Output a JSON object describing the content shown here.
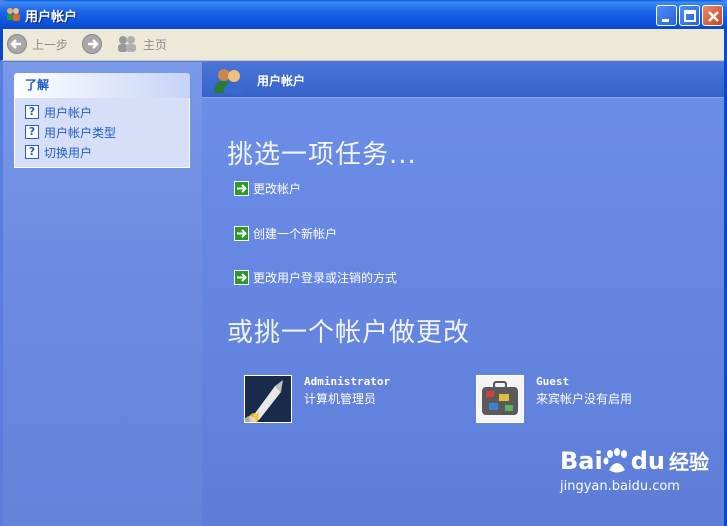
{
  "window": {
    "title": "用户帐户"
  },
  "toolbar": {
    "back_label": "上一步",
    "home_label": "主页"
  },
  "sidebar": {
    "header": "了解",
    "links": [
      {
        "label": "用户帐户"
      },
      {
        "label": "用户帐户类型"
      },
      {
        "label": "切换用户"
      }
    ]
  },
  "main": {
    "header_title": "用户帐户",
    "task_heading": "挑选一项任务...",
    "tasks": [
      {
        "label": "更改帐户"
      },
      {
        "label": "创建一个新帐户"
      },
      {
        "label": "更改用户登录或注销的方式"
      }
    ],
    "account_heading": "或挑一个帐户做更改",
    "accounts": [
      {
        "name": "Administrator",
        "description": "计算机管理员"
      },
      {
        "name": "Guest",
        "description": "来宾帐户没有启用"
      }
    ]
  },
  "watermark": {
    "brand": "Bai",
    "brand_suffix": "du",
    "product": "经验",
    "url": "jingyan.baidu.com"
  },
  "colors": {
    "title_bar": "#0a54df",
    "main_background": "#5d7dd9",
    "sidebar_link": "#215dc6",
    "task_arrow": "#2b9a2b"
  }
}
